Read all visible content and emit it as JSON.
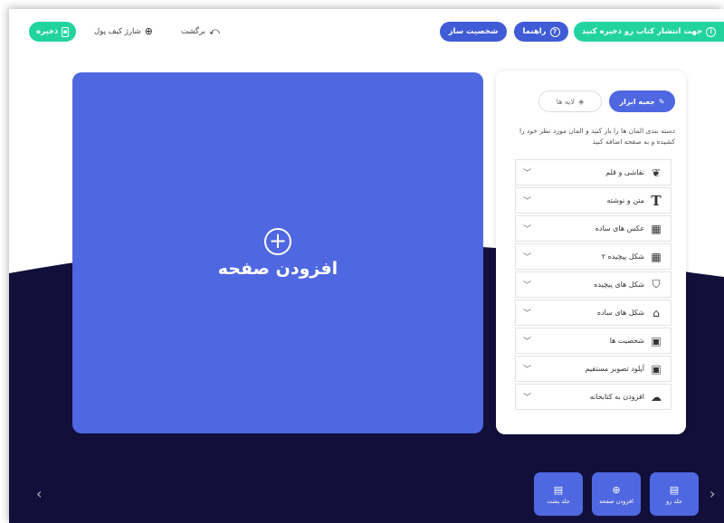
{
  "header": {
    "save_button": "ذخیره",
    "wallet_link": "شارژ کیف پول",
    "back_link": "برگشت",
    "personality_button": "شخصیت ساز",
    "guide_button": "راهنما",
    "publish_button": "جهت انتشار کتاب رو ذخیره کنید"
  },
  "canvas": {
    "add_page_label": "افزودن صفحه"
  },
  "panel": {
    "tab_tools": "جعبه ابزار",
    "tab_layers": "لایه ها",
    "hint": "دسته بندی المان ها را باز کنید و المان مورد نظر خود را کشیده و به صفحه اضافه کنید",
    "categories": [
      {
        "label": "نقاشی و قلم",
        "icon": "brush-icon"
      },
      {
        "label": "متن و نوشته",
        "icon": "text-icon"
      },
      {
        "label": "عکس های ساده",
        "icon": "image-icon"
      },
      {
        "label": "شکل پیچیده ۲",
        "icon": "image-icon"
      },
      {
        "label": "شکل های پیچیده",
        "icon": "shirt-icon"
      },
      {
        "label": "شکل های ساده",
        "icon": "home-icon"
      },
      {
        "label": "شخصیت ها",
        "icon": "picture-icon"
      },
      {
        "label": "آپلود تصویر مستقیم",
        "icon": "picture-icon"
      },
      {
        "label": "افزودن به کتابخانه",
        "icon": "cloud-upload-icon"
      }
    ]
  },
  "footer": {
    "front_cover": "جلد رو",
    "add_page": "افزودن صفحه",
    "back_cover": "جلد پشت"
  },
  "colors": {
    "primary": "#4f67e0",
    "accent_green": "#22d3a0",
    "dark_bg": "#12103a"
  }
}
